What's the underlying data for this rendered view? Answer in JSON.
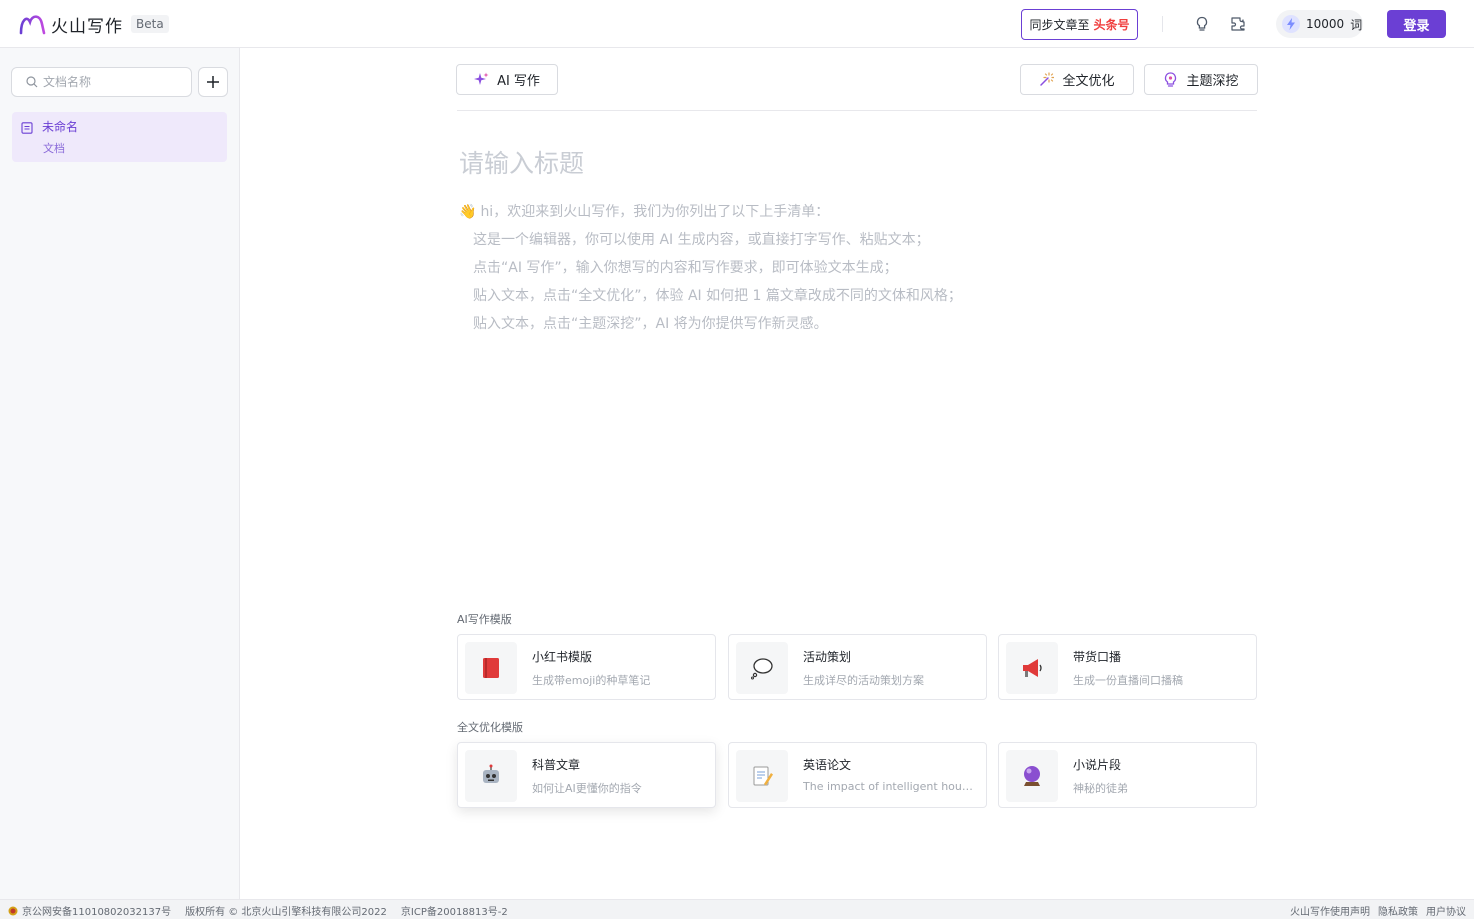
{
  "header": {
    "logo_text": "火山写作",
    "beta": "Beta",
    "sync_label": "同步文章至",
    "sync_brand": "头条号",
    "quota_value": "10000",
    "quota_unit": "词",
    "login": "登录",
    "icons": [
      "lightbulb-icon",
      "plugin-icon",
      "bolt-icon"
    ],
    "accent_color": "#6b3fd4"
  },
  "sidebar": {
    "search_placeholder": "文档名称",
    "docs": [
      {
        "name": "未命名",
        "type": "文档"
      }
    ]
  },
  "toolbar": {
    "ai_write": "AI 写作",
    "full_optimize": "全文优化",
    "topic_dig": "主题深挖"
  },
  "editor": {
    "title_placeholder": "请输入标题",
    "welcome_lines": [
      "hi，欢迎来到火山写作，我们为你列出了以下上手清单：",
      "这是一个编辑器，你可以使用 AI 生成内容，或直接打字写作、粘贴文本；",
      "点击“AI 写作”，输入你想写的内容和写作要求，即可体验文本生成；",
      "贴入文本，点击“全文优化”，体验 AI 如何把 1 篇文章改成不同的文体和风格；",
      "贴入文本，点击“主题深挖”，AI 将为你提供写作新灵感。"
    ]
  },
  "templates": {
    "ai_label": "AI写作模版",
    "ai_items": [
      {
        "title": "小红书模版",
        "desc": "生成带emoji的种草笔记",
        "icon": "red-book-icon"
      },
      {
        "title": "活动策划",
        "desc": "生成详尽的活动策划方案",
        "icon": "speech-bubble-icon"
      },
      {
        "title": "带货口播",
        "desc": "生成一份直播间口播稿",
        "icon": "megaphone-icon"
      }
    ],
    "optimize_label": "全文优化模版",
    "optimize_items": [
      {
        "title": "科普文章",
        "desc": "如何让AI更懂你的指令",
        "icon": "robot-icon"
      },
      {
        "title": "英语论文",
        "desc": "The impact of intelligent household appliances",
        "icon": "memo-icon"
      },
      {
        "title": "小说片段",
        "desc": "神秘的徒弟",
        "icon": "crystal-ball-icon"
      }
    ]
  },
  "footer": {
    "police_record": "京公网安备11010802032137号",
    "copyright": "版权所有 © 北京火山引擎科技有限公司2022",
    "icp": "京ICP备20018813号-2",
    "links": [
      "火山写作使用声明",
      "隐私政策",
      "用户协议"
    ]
  }
}
